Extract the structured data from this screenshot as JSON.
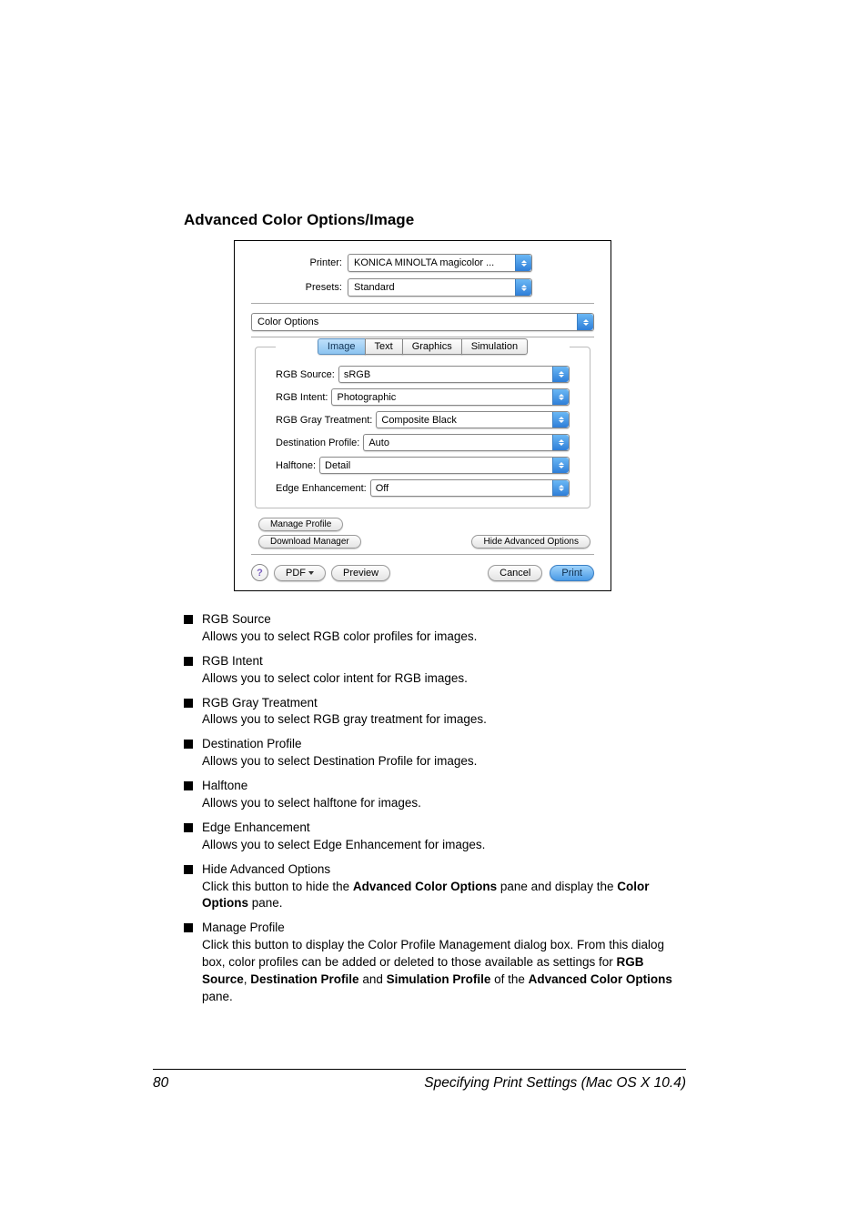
{
  "heading": "Advanced Color Options/Image",
  "dialog": {
    "printer_label": "Printer:",
    "printer_value": "KONICA MINOLTA magicolor ...",
    "presets_label": "Presets:",
    "presets_value": "Standard",
    "panel_value": "Color Options",
    "tabs": [
      "Image",
      "Text",
      "Graphics",
      "Simulation"
    ],
    "fields": {
      "rgb_source_label": "RGB Source:",
      "rgb_source_value": "sRGB",
      "rgb_intent_label": "RGB Intent:",
      "rgb_intent_value": "Photographic",
      "rgb_gray_label": "RGB Gray Treatment:",
      "rgb_gray_value": "Composite Black",
      "dest_profile_label": "Destination Profile:",
      "dest_profile_value": "Auto",
      "halftone_label": "Halftone:",
      "halftone_value": "Detail",
      "edge_label": "Edge Enhancement:",
      "edge_value": "Off"
    },
    "manage_profile": "Manage Profile",
    "download_manager": "Download Manager",
    "hide_advanced": "Hide Advanced Options",
    "help": "?",
    "pdf": "PDF",
    "preview": "Preview",
    "cancel": "Cancel",
    "print": "Print"
  },
  "list": [
    {
      "title": "RGB Source",
      "desc": "Allows you to select RGB color profiles for images."
    },
    {
      "title": "RGB Intent",
      "desc": "Allows you to select color intent for RGB images."
    },
    {
      "title": "RGB Gray Treatment",
      "desc": "Allows you to select RGB gray treatment for images."
    },
    {
      "title": "Destination Profile",
      "desc": "Allows you to select Destination Profile for images."
    },
    {
      "title": "Halftone",
      "desc": "Allows you to select halftone for images."
    },
    {
      "title": "Edge Enhancement",
      "desc": "Allows you to select Edge Enhancement for images."
    }
  ],
  "hide_item": {
    "title": "Hide Advanced Options",
    "pre": "Click this button to hide the ",
    "b1": "Advanced Color Options",
    "mid": " pane and display the ",
    "b2": "Color Options",
    "post": " pane."
  },
  "manage_item": {
    "title": "Manage Profile",
    "l1": "Click this button to display the Color Profile Management dialog box. From this dialog box, color profiles can be added or deleted to those available as settings for ",
    "b1": "RGB Source",
    "c1": ", ",
    "b2": "Destination Profile",
    "c2": " and ",
    "b3": "Simulation Profile",
    "c3": " of the ",
    "b4": "Advanced Color Options",
    "post": " pane."
  },
  "footer": {
    "page": "80",
    "title": "Specifying Print Settings (Mac OS X 10.4)"
  }
}
